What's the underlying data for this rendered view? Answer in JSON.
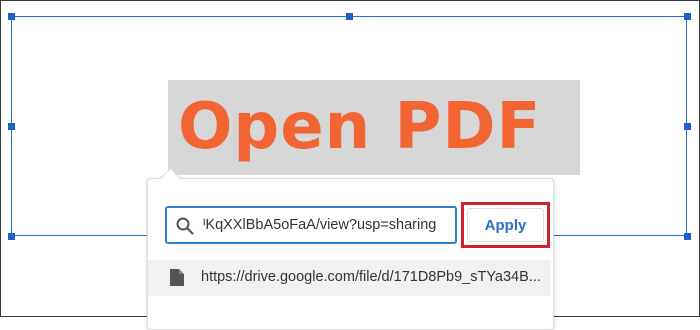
{
  "heading": {
    "text": "Open PDF"
  },
  "link_popup": {
    "url_input": {
      "value": "ᴵKqXXlBbA5oFaA/view?usp=sharing",
      "icon": "search-icon"
    },
    "apply_label": "Apply",
    "suggestion": {
      "icon": "file-icon",
      "text": "https://drive.google.com/file/d/171D8Pb9_sTYa34B..."
    }
  },
  "colors": {
    "heading_text": "#f26431",
    "selection_border": "#2a6dd4",
    "input_focus_border": "#2d7fd3",
    "apply_text": "#2d6fc2",
    "highlight_border": "#d1202f"
  }
}
